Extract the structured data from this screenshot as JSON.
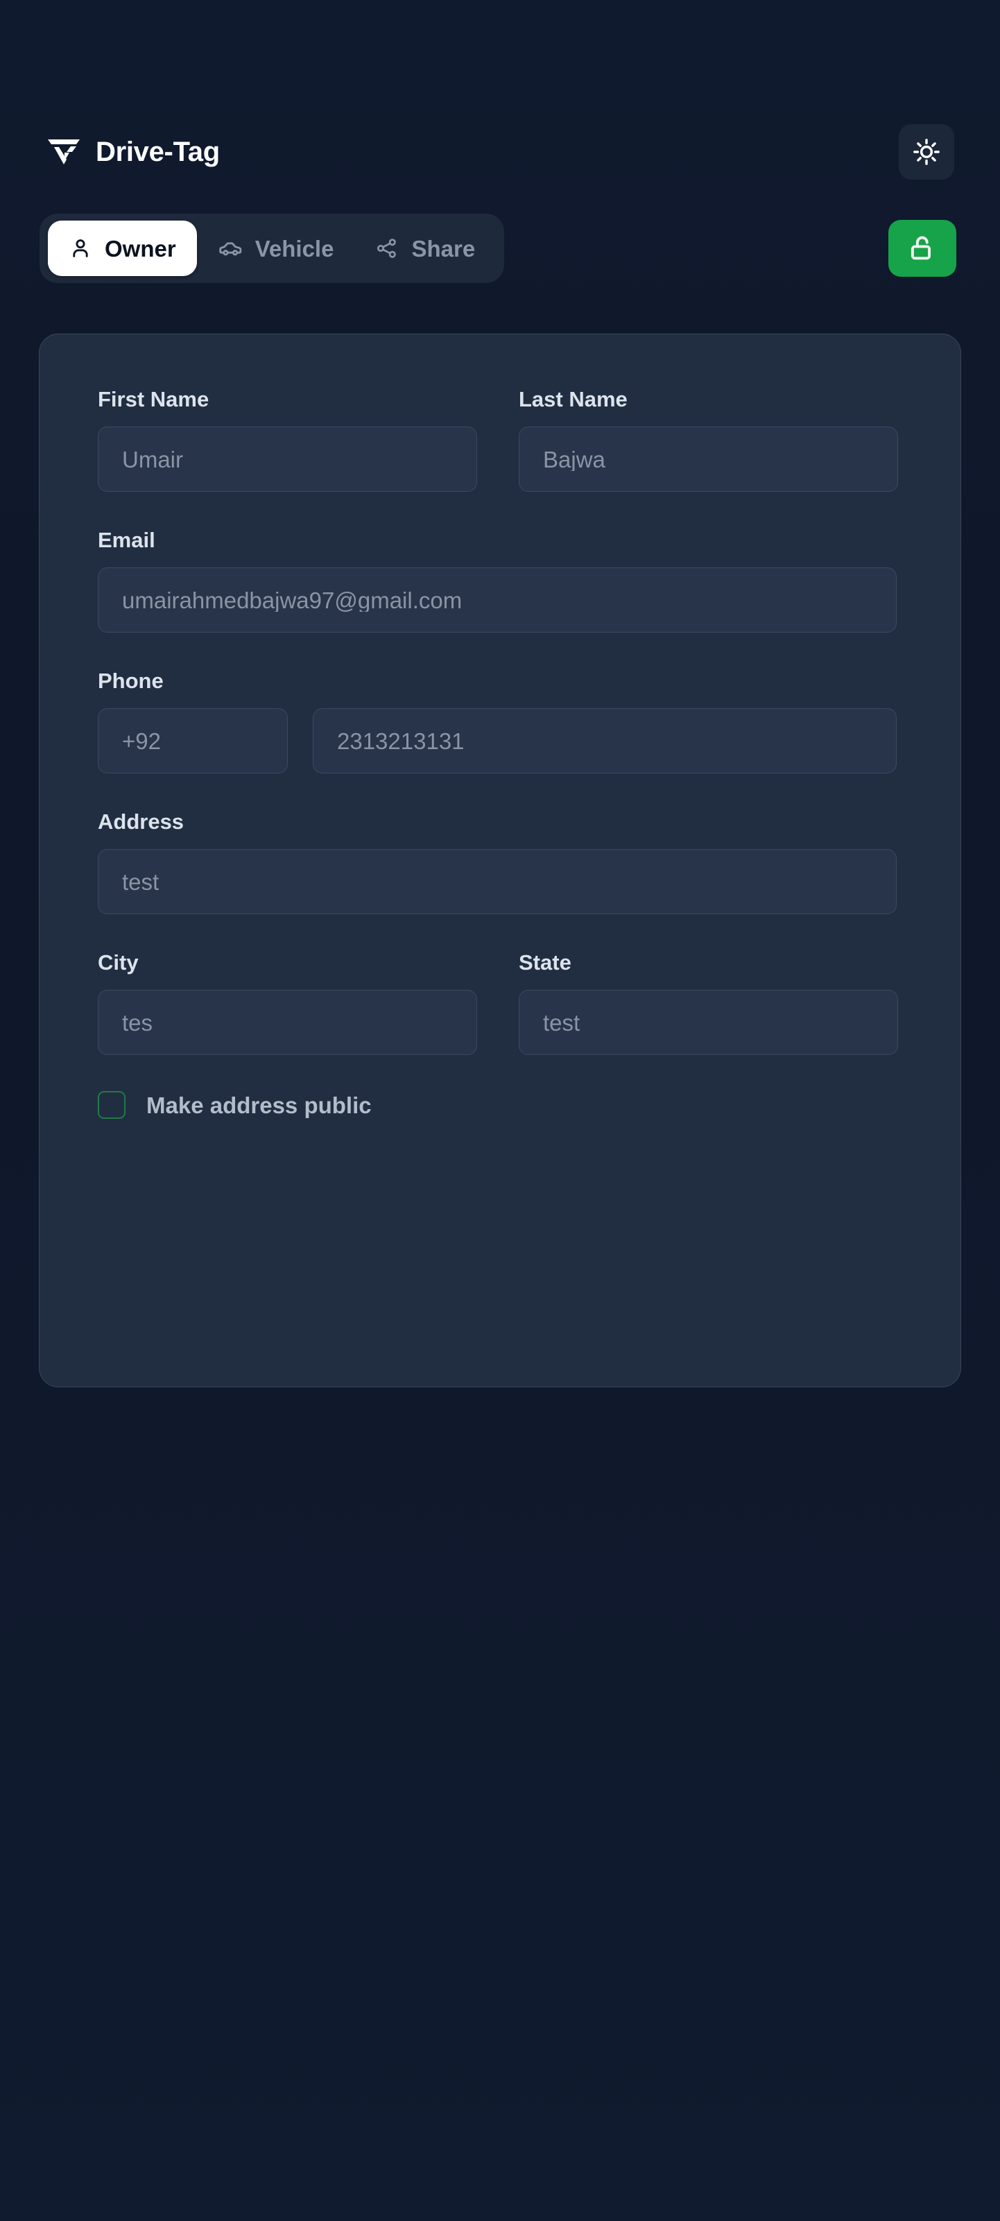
{
  "app": {
    "brand_name": "Drive-Tag",
    "logo_icon": "drive-tag-logo-icon",
    "accent_green": "#17a34a",
    "background": "#0f172a",
    "card_background": "#212e42"
  },
  "header": {
    "theme_toggle": {
      "icon": "sun-icon",
      "label": "Toggle theme"
    }
  },
  "tabs": {
    "items": [
      {
        "id": "owner",
        "label": "Owner",
        "icon": "user-icon",
        "active": true
      },
      {
        "id": "vehicle",
        "label": "Vehicle",
        "icon": "car-icon",
        "active": false
      },
      {
        "id": "share",
        "label": "Share",
        "icon": "share-icon",
        "active": false
      }
    ],
    "lock_button": {
      "icon": "unlock-icon",
      "state": "unlocked",
      "color": "#17a34a"
    }
  },
  "form": {
    "first_name": {
      "label": "First Name",
      "value": "Umair",
      "placeholder": "Umair"
    },
    "last_name": {
      "label": "Last Name",
      "value": "Bajwa",
      "placeholder": "Bajwa"
    },
    "email": {
      "label": "Email",
      "value": "umairahmedbajwa97@gmail.com",
      "placeholder": "umairahmedbajwa97@gmail.com"
    },
    "phone": {
      "label": "Phone",
      "country_code": "+92",
      "country_code_placeholder": "+92",
      "number": "2313213131",
      "number_placeholder": "2313213131"
    },
    "address": {
      "label": "Address",
      "value": "test",
      "placeholder": "test"
    },
    "city": {
      "label": "City",
      "value": "tes",
      "placeholder": "tes"
    },
    "state": {
      "label": "State",
      "value": "test",
      "placeholder": "test"
    },
    "make_address_public": {
      "label": "Make address public",
      "checked": false
    }
  }
}
